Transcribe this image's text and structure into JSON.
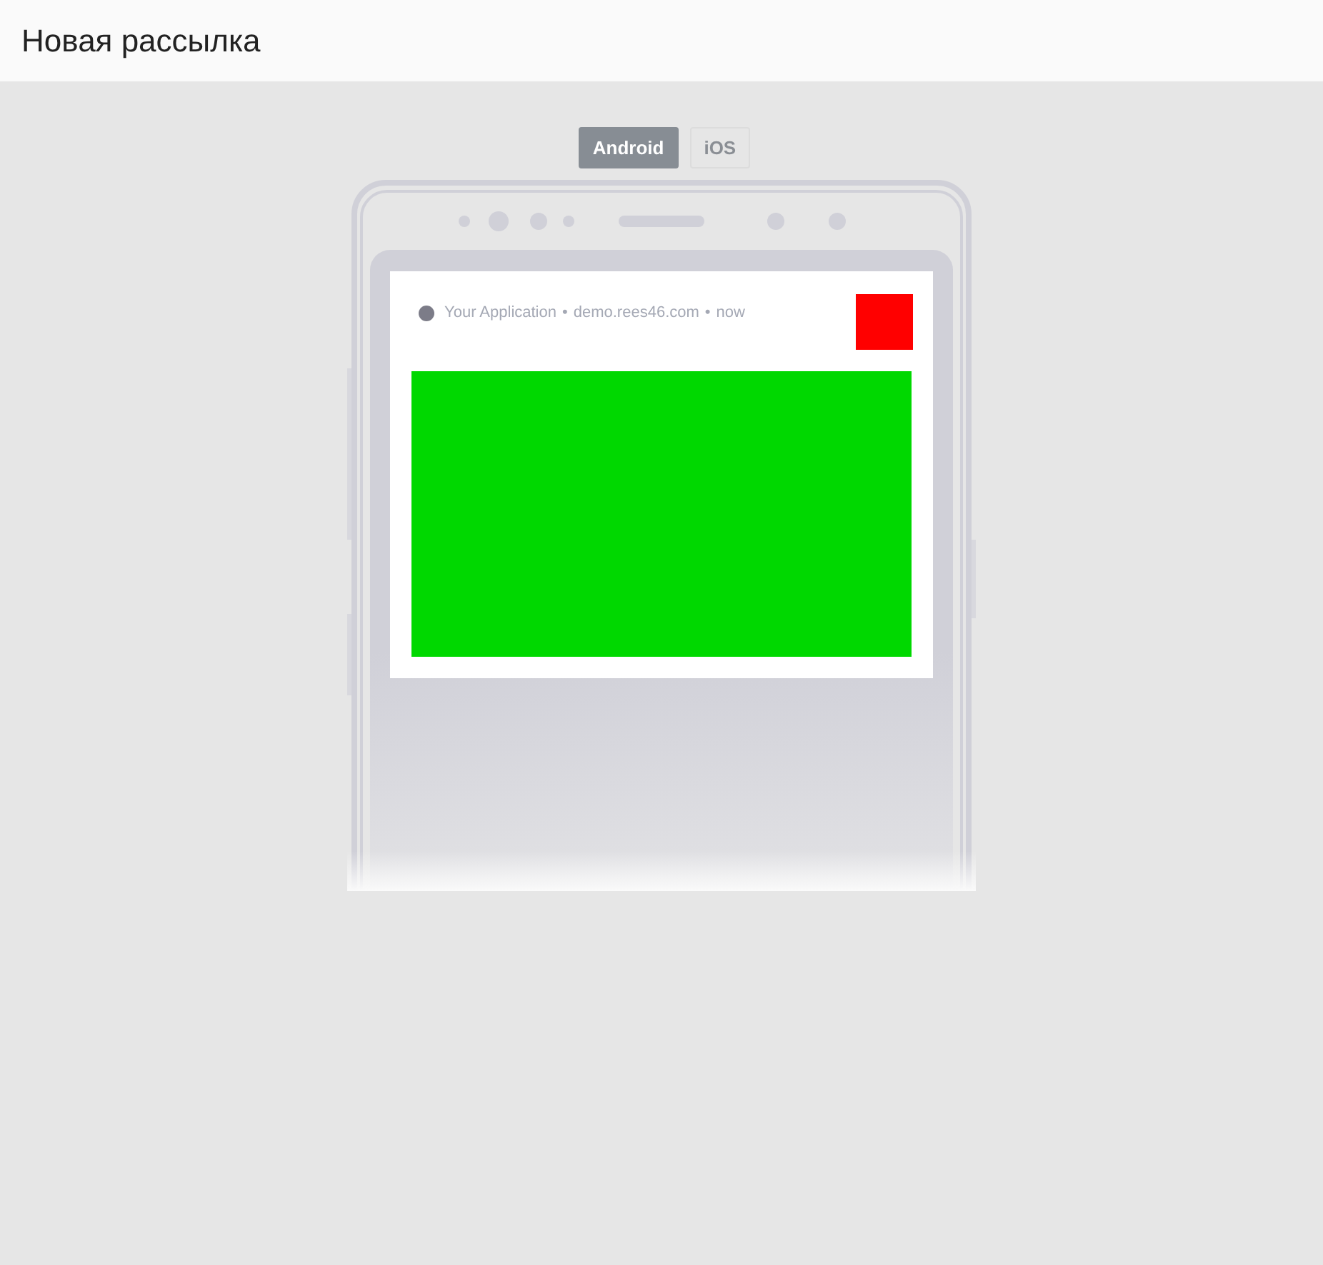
{
  "header": {
    "title": "Новая рассылка"
  },
  "tabs": [
    {
      "label": "Android",
      "selected": true
    },
    {
      "label": "iOS",
      "selected": false
    }
  ],
  "notification": {
    "app": "Your Application",
    "separator_1": "•",
    "site": "demo.rees46.com",
    "separator_2": "•",
    "time": "now"
  }
}
